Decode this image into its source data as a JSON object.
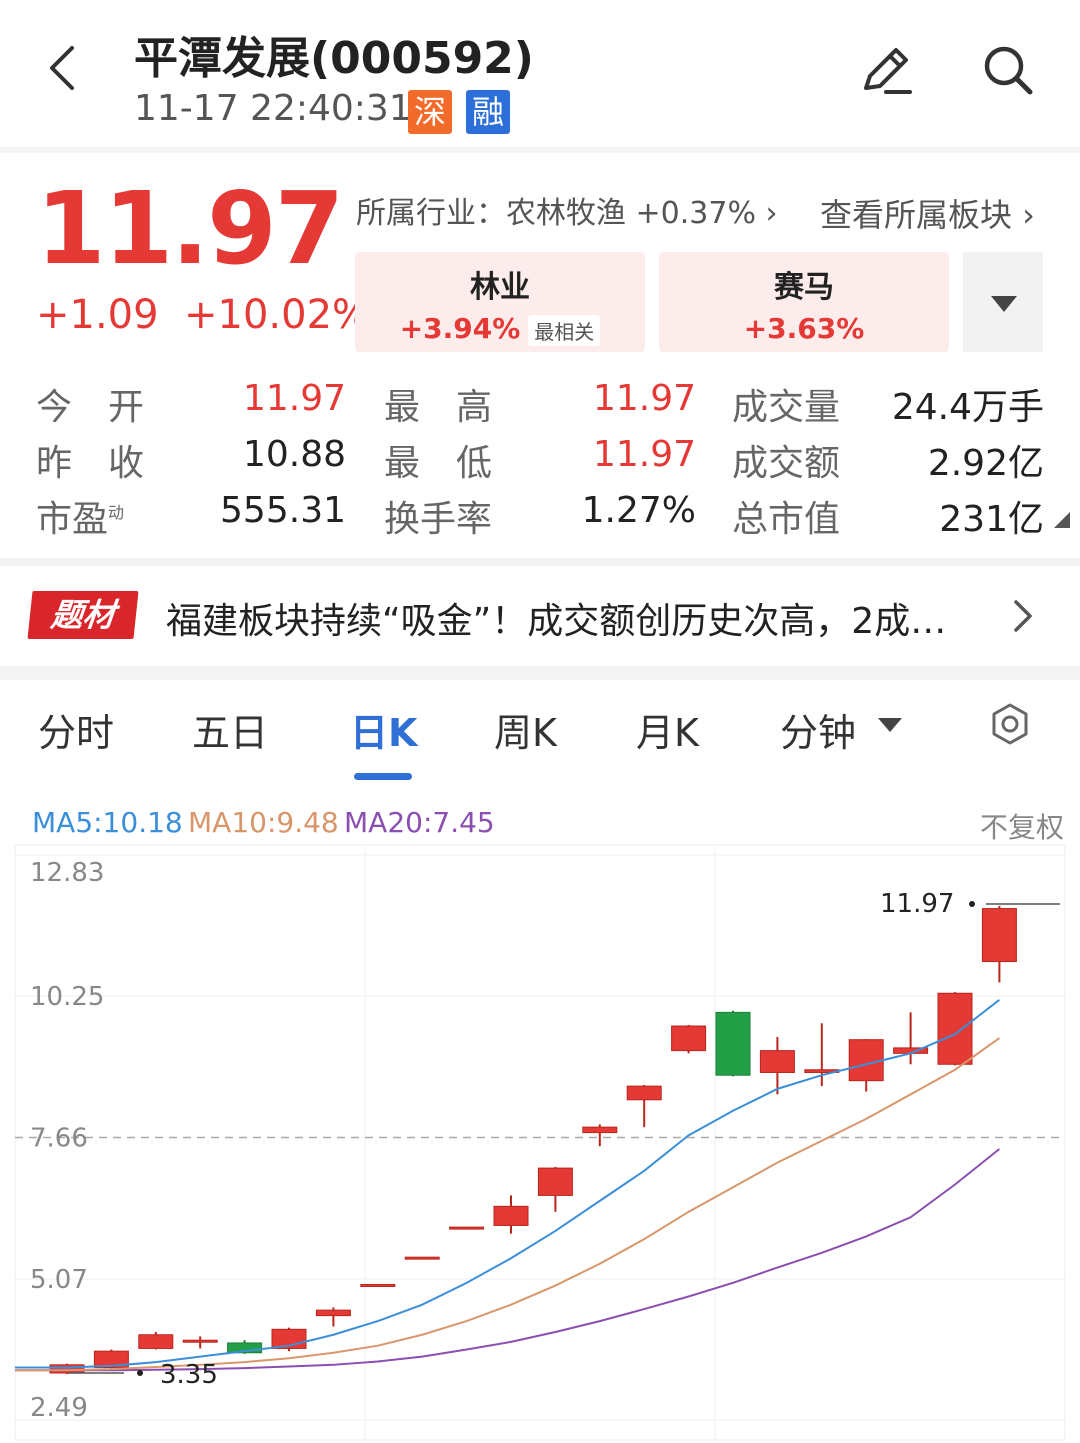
{
  "header": {
    "title": "平潭发展(000592)",
    "datetime": "11-17 22:40:31",
    "badge_exchange": "深",
    "badge_margin": "融",
    "icons": [
      "back-icon",
      "edit-icon",
      "search-icon"
    ]
  },
  "quote": {
    "price": "11.97",
    "change": "+1.09",
    "change_pct": "+10.02%",
    "industry_text": "所属行业：农林牧渔 +0.37% ›",
    "view_sector": "查看所属板块 ›",
    "tags": [
      {
        "name": "林业",
        "pct": "+3.94%",
        "note": "最相关"
      },
      {
        "name": "赛马",
        "pct": "+3.63%"
      }
    ],
    "colors": {
      "up": "#e53935",
      "down": "#23a047",
      "accent": "#2f6fd6"
    }
  },
  "stats": {
    "open_label": "今　开",
    "open": "11.97",
    "high_label": "最　高",
    "high": "11.97",
    "vol_label": "成交量",
    "vol": "24.4万手",
    "prev_label": "昨　收",
    "prev": "10.88",
    "low_label": "最　低",
    "low": "11.97",
    "amount_label": "成交额",
    "amount": "2.92亿",
    "pe_label": "市盈",
    "pe_sup": "动",
    "pe": "555.31",
    "turnover_label": "换手率",
    "turnover": "1.27%",
    "mcap_label": "总市值",
    "mcap": "231亿"
  },
  "news": {
    "badge": "题材",
    "text": "福建板块持续“吸金”！成交额创历史次高，2成…"
  },
  "tabs": {
    "items": [
      "分时",
      "五日",
      "日K",
      "周K",
      "月K",
      "分钟"
    ],
    "active": "日K"
  },
  "ma": {
    "ma5": "MA5:10.18",
    "ma10": "MA10:9.48",
    "ma20": "MA20:7.45",
    "adjust": "不复权"
  },
  "chart_data": {
    "type": "candlestick",
    "y_ticks": [
      "12.83",
      "10.25",
      "7.66",
      "5.07",
      "2.49"
    ],
    "ylim": [
      2.49,
      12.83
    ],
    "dashed_line": 7.66,
    "max_label": "11.97",
    "min_label": "3.35",
    "candles": [
      {
        "o": 3.35,
        "c": 3.5,
        "h": 3.52,
        "l": 3.33
      },
      {
        "o": 3.45,
        "c": 3.75,
        "h": 3.78,
        "l": 3.4
      },
      {
        "o": 3.8,
        "c": 4.05,
        "h": 4.1,
        "l": 3.78
      },
      {
        "o": 3.92,
        "c": 3.95,
        "h": 4.02,
        "l": 3.8
      },
      {
        "o": 3.9,
        "c": 3.72,
        "h": 3.95,
        "l": 3.7
      },
      {
        "o": 3.8,
        "c": 4.15,
        "h": 4.18,
        "l": 3.75
      },
      {
        "o": 4.4,
        "c": 4.5,
        "h": 4.55,
        "l": 4.2
      },
      {
        "o": 4.95,
        "c": 4.97,
        "h": 4.97,
        "l": 4.95
      },
      {
        "o": 5.45,
        "c": 5.47,
        "h": 5.47,
        "l": 5.45
      },
      {
        "o": 6.0,
        "c": 6.02,
        "h": 6.02,
        "l": 6.0
      },
      {
        "o": 6.05,
        "c": 6.4,
        "h": 6.6,
        "l": 5.9
      },
      {
        "o": 6.6,
        "c": 7.1,
        "h": 7.12,
        "l": 6.3
      },
      {
        "o": 7.75,
        "c": 7.85,
        "h": 7.9,
        "l": 7.5
      },
      {
        "o": 8.35,
        "c": 8.6,
        "h": 8.62,
        "l": 7.85
      },
      {
        "o": 9.25,
        "c": 9.7,
        "h": 9.72,
        "l": 9.2
      },
      {
        "o": 9.95,
        "c": 8.8,
        "h": 9.98,
        "l": 8.78
      },
      {
        "o": 8.85,
        "c": 9.25,
        "h": 9.5,
        "l": 8.45
      },
      {
        "o": 8.85,
        "c": 8.9,
        "h": 9.75,
        "l": 8.6
      },
      {
        "o": 8.7,
        "c": 9.45,
        "h": 9.46,
        "l": 8.5
      },
      {
        "o": 9.2,
        "c": 9.3,
        "h": 9.95,
        "l": 9.0
      },
      {
        "o": 9.0,
        "c": 10.3,
        "h": 10.32,
        "l": 8.98
      },
      {
        "o": 10.88,
        "c": 11.85,
        "h": 11.9,
        "l": 10.5
      }
    ],
    "ma5": [
      3.45,
      3.48,
      3.55,
      3.65,
      3.75,
      3.85,
      4.05,
      4.3,
      4.6,
      5.0,
      5.45,
      5.95,
      6.5,
      7.05,
      7.7,
      8.15,
      8.55,
      8.8,
      9.0,
      9.2,
      9.55,
      10.18
    ],
    "ma10": [
      3.4,
      3.42,
      3.46,
      3.5,
      3.55,
      3.62,
      3.72,
      3.85,
      4.05,
      4.3,
      4.6,
      4.95,
      5.35,
      5.8,
      6.3,
      6.75,
      7.2,
      7.6,
      8.0,
      8.45,
      8.9,
      9.48
    ],
    "ma20": [
      3.4,
      3.4,
      3.41,
      3.42,
      3.44,
      3.47,
      3.5,
      3.56,
      3.65,
      3.78,
      3.92,
      4.1,
      4.3,
      4.52,
      4.75,
      5.0,
      5.28,
      5.55,
      5.85,
      6.2,
      6.8,
      7.45
    ]
  }
}
